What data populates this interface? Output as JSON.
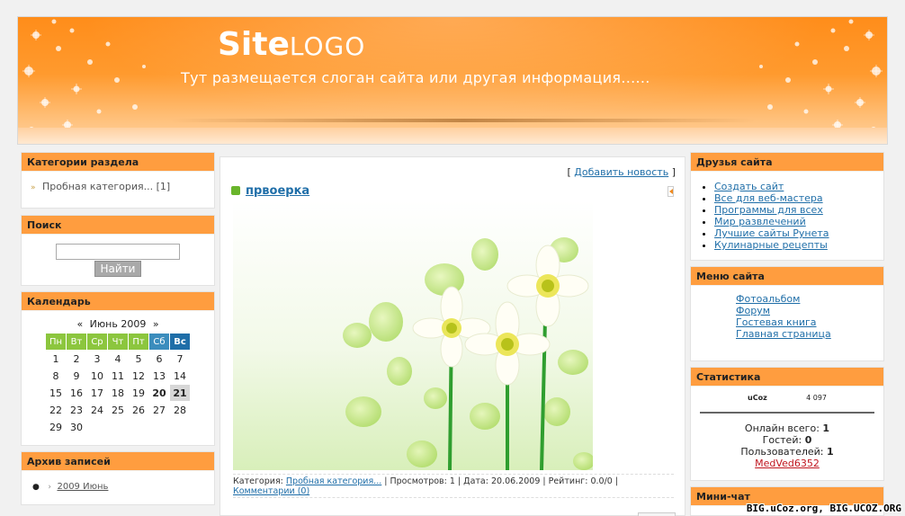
{
  "header": {
    "logo_bold": "Site",
    "logo_thin": "LOGO",
    "slogan": "Тут размещается слоган сайта или другая информация......"
  },
  "left": {
    "categories": {
      "title": "Категории раздела",
      "item": "Пробная категория...",
      "count": "[1]"
    },
    "search": {
      "title": "Поиск",
      "button": "Найти"
    },
    "calendar": {
      "title": "Календарь",
      "prev": "«",
      "next": "»",
      "month": "Июнь 2009",
      "days": [
        "Пн",
        "Вт",
        "Ср",
        "Чт",
        "Пт",
        "Сб",
        "Вс"
      ],
      "weeks": [
        [
          "1",
          "2",
          "3",
          "4",
          "5",
          "6",
          "7"
        ],
        [
          "8",
          "9",
          "10",
          "11",
          "12",
          "13",
          "14"
        ],
        [
          "15",
          "16",
          "17",
          "18",
          "19",
          "20",
          "21"
        ],
        [
          "22",
          "23",
          "24",
          "25",
          "26",
          "27",
          "28"
        ],
        [
          "29",
          "30",
          "",
          "",
          "",
          "",
          ""
        ]
      ]
    },
    "archive": {
      "title": "Архив записей",
      "item": "2009 Июнь"
    }
  },
  "main": {
    "add_news": "Добавить новость",
    "bracket_open": "[",
    "bracket_close": "]",
    "news_title": "првоерка",
    "meta": {
      "category_label": "Категория:",
      "category_link": "Пробная категория...",
      "rest": " | Просмотров: 1 | Дата: 20.06.2009 | Рейтинг: 0.0/0 |",
      "comments": "Комментарии (0)"
    }
  },
  "right": {
    "friends": {
      "title": "Друзья сайта",
      "links": [
        "Создать сайт",
        "Все для веб-мастера",
        "Программы для всех",
        "Мир развлечений",
        "Лучшие сайты Рунета",
        "Кулинарные рецепты"
      ]
    },
    "menu": {
      "title": "Меню сайта",
      "links": [
        "Фотоальбом",
        "Форум",
        "Гостевая книга",
        "Главная страница"
      ]
    },
    "stats": {
      "title": "Статистика",
      "counter_brand": "uCoz",
      "counter_number": "4 097",
      "online_label": "Онлайн всего:",
      "online_value": "1",
      "guests_label": "Гостей:",
      "guests_value": "0",
      "users_label": "Пользователей:",
      "users_value": "1",
      "user_name": "MedVed6352"
    },
    "minichat": {
      "title": "Мини-чат"
    }
  },
  "watermark": "BIG.uCoz.org, BIG.UCOZ.ORG",
  "colors": {
    "accent_orange": "#ff9d3f",
    "link_blue": "#1f6ea8",
    "calendar_green": "#8cc63e"
  }
}
